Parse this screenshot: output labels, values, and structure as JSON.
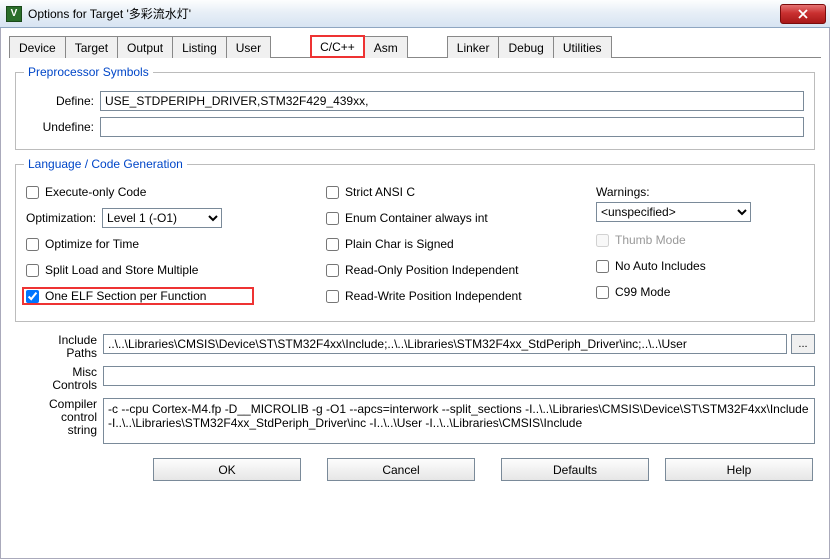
{
  "window": {
    "title": "Options for Target '多彩流水灯'"
  },
  "tabs": [
    "Device",
    "Target",
    "Output",
    "Listing",
    "User",
    "C/C++",
    "Asm",
    "Linker",
    "Debug",
    "Utilities"
  ],
  "preproc": {
    "title": "Preprocessor Symbols",
    "define_label": "Define:",
    "define_value": "USE_STDPERIPH_DRIVER,STM32F429_439xx,",
    "undefine_label": "Undefine:",
    "undefine_value": ""
  },
  "lang": {
    "title": "Language / Code Generation",
    "execute_only": "Execute-only Code",
    "optimization_label": "Optimization:",
    "optimization_value": "Level 1 (-O1)",
    "optimize_time": "Optimize for Time",
    "split_load": "Split Load and Store Multiple",
    "one_elf": "One ELF Section per Function",
    "strict_ansi": "Strict ANSI C",
    "enum_container": "Enum Container always int",
    "plain_char": "Plain Char is Signed",
    "ro_pi": "Read-Only Position Independent",
    "rw_pi": "Read-Write Position Independent",
    "warnings_label": "Warnings:",
    "warnings_value": "<unspecified>",
    "thumb": "Thumb Mode",
    "no_auto": "No Auto Includes",
    "c99": "C99 Mode"
  },
  "paths": {
    "include_label": "Include\nPaths",
    "include_value": "..\\..\\Libraries\\CMSIS\\Device\\ST\\STM32F4xx\\Include;..\\..\\Libraries\\STM32F4xx_StdPeriph_Driver\\inc;..\\..\\User",
    "misc_label": "Misc\nControls",
    "misc_value": "",
    "compiler_label": "Compiler\ncontrol\nstring",
    "compiler_value": "-c --cpu Cortex-M4.fp -D__MICROLIB -g -O1 --apcs=interwork --split_sections -I..\\..\\Libraries\\CMSIS\\Device\\ST\\STM32F4xx\\Include -I..\\..\\Libraries\\STM32F4xx_StdPeriph_Driver\\inc -I..\\..\\User -I..\\..\\Libraries\\CMSIS\\Include"
  },
  "buttons": {
    "ok": "OK",
    "cancel": "Cancel",
    "defaults": "Defaults",
    "help": "Help",
    "browse": "..."
  }
}
